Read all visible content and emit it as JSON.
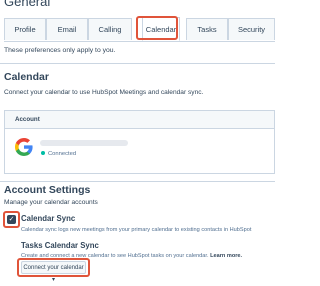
{
  "page": {
    "title": "General"
  },
  "tabs": [
    {
      "label": "Profile"
    },
    {
      "label": "Email"
    },
    {
      "label": "Calling"
    },
    {
      "label": "Calendar"
    },
    {
      "label": "Tasks"
    },
    {
      "label": "Security"
    }
  ],
  "note": "These preferences only apply to you.",
  "calendar": {
    "title": "Calendar",
    "description": "Connect your calendar to use HubSpot Meetings and calendar sync.",
    "account_header": "Account",
    "account_icon": "google-g-icon",
    "account_status": "Connected"
  },
  "account_settings": {
    "title": "Account Settings",
    "description": "Manage your calendar accounts",
    "calendar_sync": {
      "label": "Calendar Sync",
      "checked": true,
      "description": "Calendar sync logs new meetings from your primary calendar to existing contacts in HubSpot"
    },
    "tasks_sync": {
      "label": "Tasks Calendar Sync",
      "description": "Create and connect a new calendar to see HubSpot tasks on your calendar.",
      "learn_more": "Learn more.",
      "dropdown_label": "Connect your calendar"
    }
  },
  "colors": {
    "highlight": "#e0543a",
    "text": "#33475b",
    "connected": "#00bda5"
  }
}
